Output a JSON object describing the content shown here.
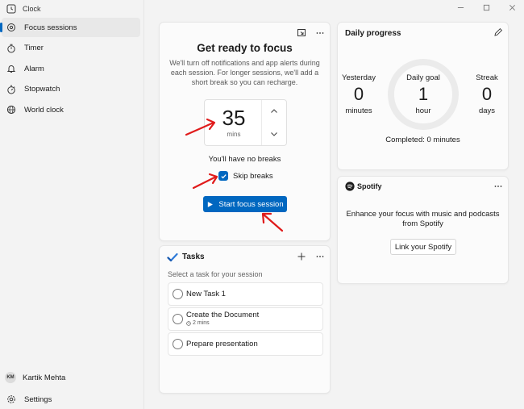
{
  "app": {
    "title": "Clock"
  },
  "sidebar": {
    "items": [
      {
        "label": "Focus sessions",
        "icon": "focus-icon",
        "active": true
      },
      {
        "label": "Timer",
        "icon": "timer-icon"
      },
      {
        "label": "Alarm",
        "icon": "alarm-icon"
      },
      {
        "label": "Stopwatch",
        "icon": "stopwatch-icon"
      },
      {
        "label": "World clock",
        "icon": "globe-icon"
      }
    ],
    "user": {
      "initials": "KM",
      "name": "Kartik Mehta"
    },
    "settings_label": "Settings"
  },
  "focus": {
    "title": "Get ready to focus",
    "description": "We'll turn off notifications and app alerts during each session. For longer sessions, we'll add a short break so you can recharge.",
    "minutes": "35",
    "unit": "mins",
    "no_breaks": "You'll have no breaks",
    "skip_breaks_label": "Skip breaks",
    "skip_breaks_checked": true,
    "start_label": "Start focus session"
  },
  "tasks": {
    "title": "Tasks",
    "hint": "Select a task for your session",
    "items": [
      {
        "label": "New Task 1"
      },
      {
        "label": "Create the Document",
        "sub": "2 mins"
      },
      {
        "label": "Prepare presentation"
      }
    ]
  },
  "daily_progress": {
    "title": "Daily progress",
    "yesterday": {
      "label": "Yesterday",
      "value": "0",
      "unit": "minutes"
    },
    "goal": {
      "label": "Daily goal",
      "value": "1",
      "unit": "hour"
    },
    "streak": {
      "label": "Streak",
      "value": "0",
      "unit": "days"
    },
    "goal_progress": 0,
    "completed": "Completed: 0 minutes"
  },
  "spotify": {
    "brand": "Spotify",
    "description": "Enhance your focus with music and podcasts from Spotify",
    "link_label": "Link your Spotify"
  },
  "colors": {
    "accent": "#0067c0",
    "annotation": "#e01b1b",
    "spotify": "#1b1b1b"
  }
}
